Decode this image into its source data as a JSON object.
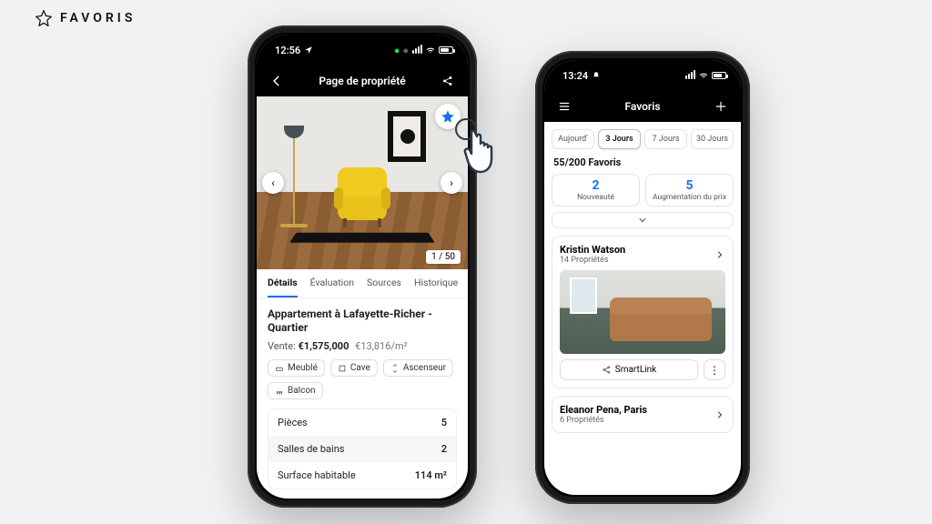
{
  "header_label": "FAVORIS",
  "phone1": {
    "status_time": "12:56",
    "nav_title": "Page de propriété",
    "image_counter": "1 / 50",
    "tabs": [
      "Détails",
      "Évaluation",
      "Sources",
      "Historique"
    ],
    "active_tab_index": 0,
    "property_title": "Appartement à Lafayette-Richer - Quartier",
    "sale_label": "Vente:",
    "price": "€1,575,000",
    "price_per_m2": "€13,816/m²",
    "chips": [
      "Meublé",
      "Cave",
      "Ascenseur",
      "Balcon"
    ],
    "specs": [
      {
        "label": "Pièces",
        "value": "5"
      },
      {
        "label": "Salles de bains",
        "value": "2"
      },
      {
        "label": "Surface habitable",
        "value": "114 m²"
      }
    ]
  },
  "phone2": {
    "status_time": "13:24",
    "nav_title": "Favoris",
    "segments": [
      "Aujourd'",
      "3 Jours",
      "7 Jours",
      "30 Jours"
    ],
    "active_segment_index": 1,
    "count_line": "55/200 Favoris",
    "stats": [
      {
        "num": "2",
        "label": "Nouveauté"
      },
      {
        "num": "5",
        "label": "Augmentation du prix"
      }
    ],
    "cards": [
      {
        "name": "Kristin Watson",
        "sub": "14 Propriétés",
        "smartlink": "SmartLink"
      },
      {
        "name": "Eleanor Pena, Paris",
        "sub": "6 Propriétés"
      }
    ]
  }
}
